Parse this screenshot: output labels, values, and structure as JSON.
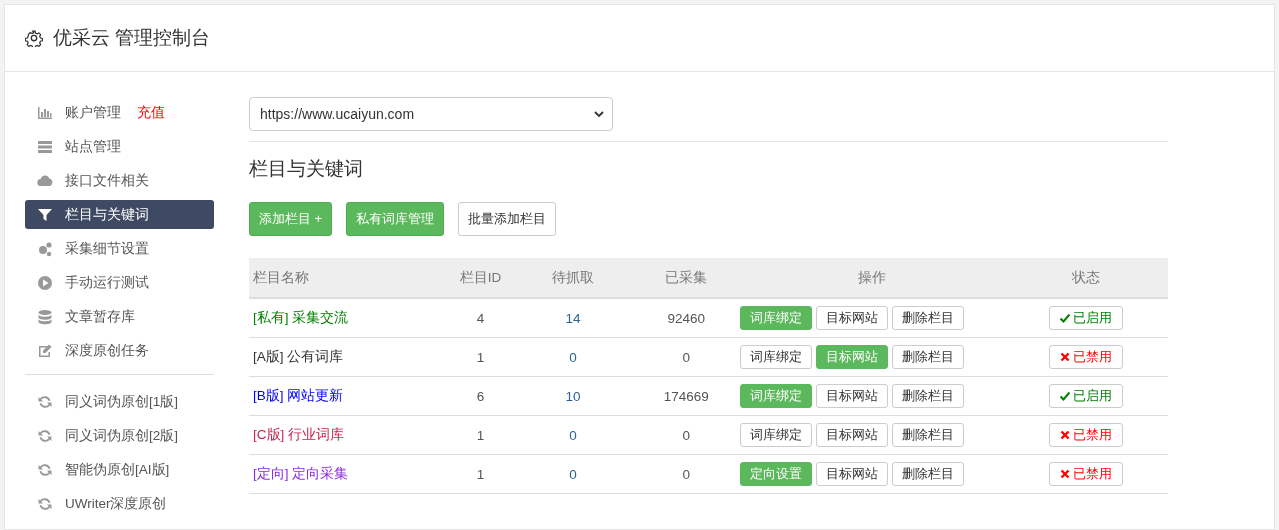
{
  "header": {
    "title": "优采云 管理控制台"
  },
  "sidebar": {
    "groups": [
      {
        "items": [
          {
            "label": "账户管理",
            "note": "充值",
            "selected": false
          },
          {
            "label": "站点管理",
            "selected": false
          },
          {
            "label": "接口文件相关",
            "selected": false
          },
          {
            "label": "栏目与关键词",
            "selected": true
          },
          {
            "label": "采集细节设置",
            "selected": false
          },
          {
            "label": "手动运行测试",
            "selected": false
          },
          {
            "label": "文章暂存库",
            "selected": false
          },
          {
            "label": "深度原创任务",
            "selected": false
          }
        ]
      },
      {
        "items": [
          {
            "label": "同义词伪原创[1版]",
            "selected": false
          },
          {
            "label": "同义词伪原创[2版]",
            "selected": false
          },
          {
            "label": "智能伪原创[AI版]",
            "selected": false
          },
          {
            "label": "UWriter深度原创",
            "selected": false
          }
        ]
      }
    ]
  },
  "site_select": {
    "value": "https://www.ucaiyun.com"
  },
  "section_title": "栏目与关键词",
  "toolbar": [
    {
      "label": "添加栏目 +",
      "primary": true
    },
    {
      "label": "私有词库管理",
      "primary": true
    },
    {
      "label": "批量添加栏目",
      "primary": false
    }
  ],
  "table": {
    "columns": [
      "栏目名称",
      "栏目ID",
      "待抓取",
      "已采集",
      "操作",
      "状态"
    ],
    "rows": [
      {
        "tag": "[私有]",
        "name": "采集交流",
        "color": "#008000",
        "id": "4",
        "pending": "14",
        "collected": "92460",
        "actions": [
          {
            "label": "词库绑定",
            "primary": true
          },
          {
            "label": "目标网站",
            "primary": false
          },
          {
            "label": "删除栏目",
            "primary": false
          }
        ],
        "enabled": true,
        "status": "已启用"
      },
      {
        "tag": "[A版]",
        "name": "公有词库",
        "color": "#333333",
        "id": "1",
        "pending": "0",
        "collected": "0",
        "actions": [
          {
            "label": "词库绑定",
            "primary": false
          },
          {
            "label": "目标网站",
            "primary": true
          },
          {
            "label": "删除栏目",
            "primary": false
          }
        ],
        "enabled": false,
        "status": "已禁用"
      },
      {
        "tag": "[B版]",
        "name": "网站更新",
        "color": "#0000ff",
        "id": "6",
        "pending": "10",
        "collected": "174669",
        "actions": [
          {
            "label": "词库绑定",
            "primary": true
          },
          {
            "label": "目标网站",
            "primary": false
          },
          {
            "label": "删除栏目",
            "primary": false
          }
        ],
        "enabled": true,
        "status": "已启用"
      },
      {
        "tag": "[C版]",
        "name": "行业词库",
        "color": "#c7254e",
        "id": "1",
        "pending": "0",
        "collected": "0",
        "actions": [
          {
            "label": "词库绑定",
            "primary": false
          },
          {
            "label": "目标网站",
            "primary": false
          },
          {
            "label": "删除栏目",
            "primary": false
          }
        ],
        "enabled": false,
        "status": "已禁用"
      },
      {
        "tag": "[定向]",
        "name": "定向采集",
        "color": "#8a2be2",
        "id": "1",
        "pending": "0",
        "collected": "0",
        "actions": [
          {
            "label": "定向设置",
            "primary": true
          },
          {
            "label": "目标网站",
            "primary": false
          },
          {
            "label": "删除栏目",
            "primary": false
          }
        ],
        "enabled": false,
        "status": "已禁用"
      }
    ]
  }
}
